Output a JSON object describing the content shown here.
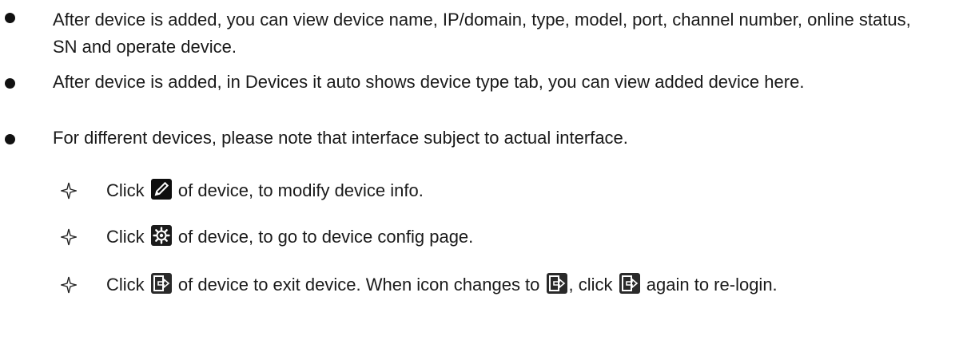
{
  "bullets": [
    "After device is added, you can view device name, IP/domain, type, model, port, channel number, online status, SN and operate device.",
    "After device is added, in Devices it auto shows device type tab, you can view added device here.",
    "For different devices, please note that interface subject to actual interface."
  ],
  "sub_items": {
    "edit": {
      "before": "Click",
      "icon": "pencil-icon",
      "after": "of device, to modify device info."
    },
    "config": {
      "before": "Click",
      "icon": "gear-icon",
      "after": "of device, to go to device config page."
    },
    "logout": {
      "before": "Click",
      "icon": "exit-icon",
      "middle1": "of device to exit device. When icon changes to",
      "middle2": ", click",
      "after": "again to re-login."
    }
  },
  "colors": {
    "text": "#1a1a1a",
    "icon_bg": "#1b1b1b",
    "icon_fg": "#ffffff"
  }
}
